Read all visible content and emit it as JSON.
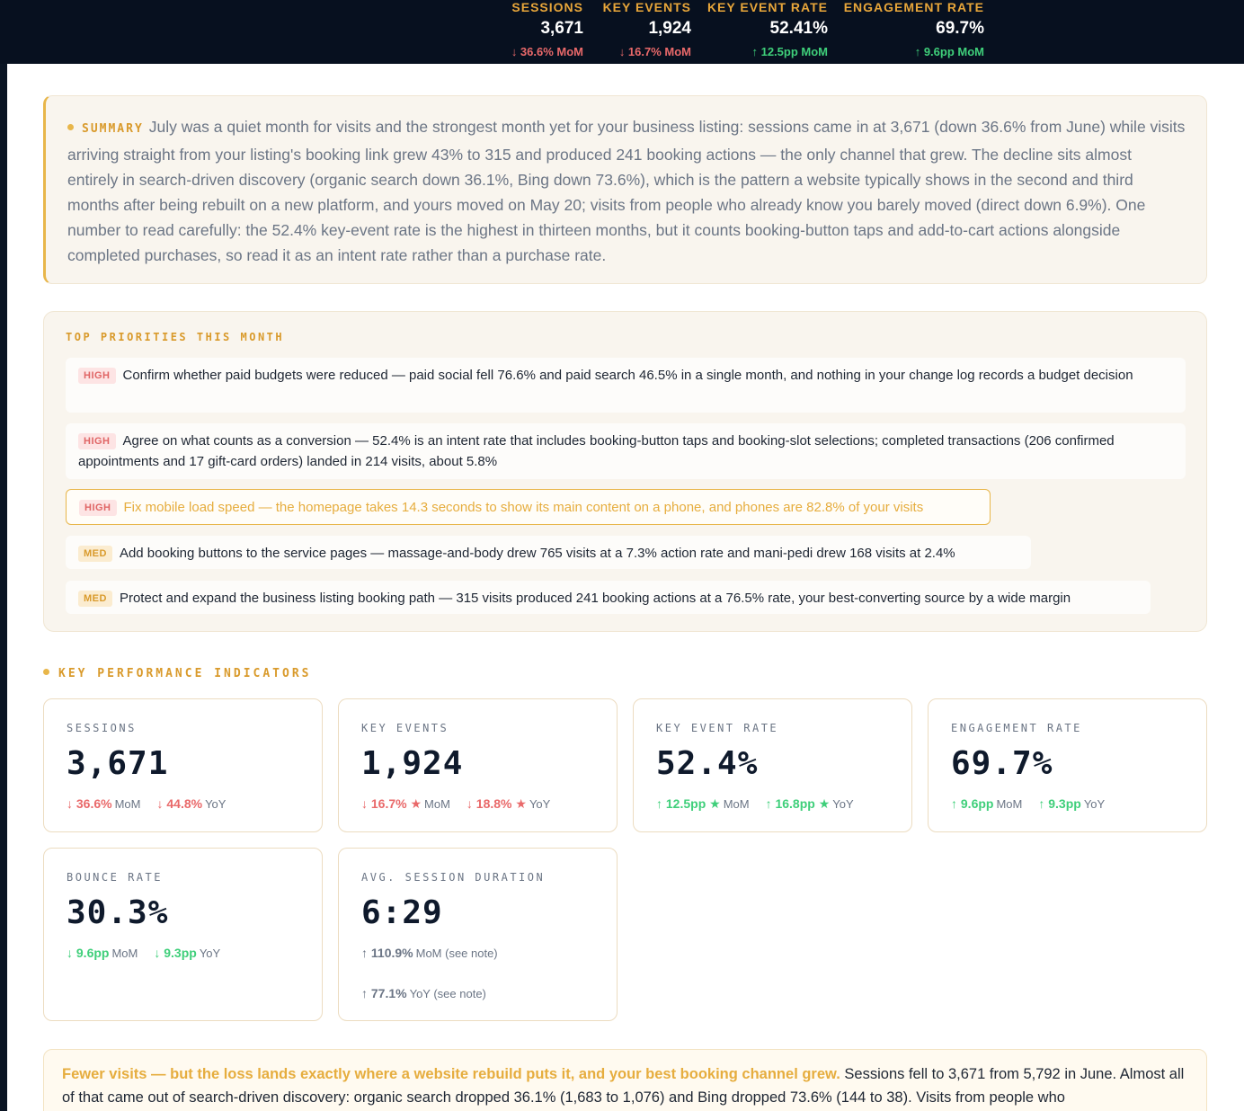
{
  "header": {
    "kpis": [
      {
        "label": "SESSIONS",
        "value": "3,671",
        "change": "↓ 36.6% MoM",
        "dir": "down-red"
      },
      {
        "label": "KEY EVENTS",
        "value": "1,924",
        "change": "↓ 16.7% MoM",
        "dir": "down-red"
      },
      {
        "label": "KEY EVENT RATE",
        "value": "52.41%",
        "change": "↑ 12.5pp MoM",
        "dir": "up-green"
      },
      {
        "label": "ENGAGEMENT RATE",
        "value": "69.7%",
        "change": "↑ 9.6pp MoM",
        "dir": "up-green"
      }
    ]
  },
  "summary": {
    "tag": "SUMMARY",
    "text": "July was a quiet month for visits and the strongest month yet for your business listing: sessions came in at 3,671 (down 36.6% from June) while visits arriving straight from your listing's booking link grew 43% to 315 and produced 241 booking actions — the only channel that grew. The decline sits almost entirely in search-driven discovery (organic search down 36.1%, Bing down 73.6%), which is the pattern a website typically shows in the second and third months after being rebuilt on a new platform, and yours moved on May 20; visits from people who already know you barely moved (direct down 6.9%). One number to read carefully: the 52.4% key-event rate is the highest in thirteen months, but it counts booking-button taps and add-to-cart actions alongside completed purchases, so read it as an intent rate rather than a purchase rate."
  },
  "priorities": {
    "title": "TOP PRIORITIES THIS MONTH",
    "items": [
      {
        "level": "HIGH",
        "text": "Confirm whether paid budgets were reduced — paid social fell 76.6% and paid search 46.5% in a single month, and nothing in your change log records a budget decision"
      },
      {
        "level": "HIGH",
        "text": "Agree on what counts as a conversion — 52.4% is an intent rate that includes booking-button taps and booking-slot selections; completed transactions (206 confirmed appointments and 17 gift-card orders) landed in 214 visits, about 5.8%"
      },
      {
        "level": "HIGH",
        "text": "Fix mobile load speed — the homepage takes 14.3 seconds to show its main content on a phone, and phones are 82.8% of your visits"
      },
      {
        "level": "MED",
        "text": "Add booking buttons to the service pages — massage-and-body drew 765 visits at a 7.3% action rate and mani-pedi drew 168 visits at 2.4%"
      },
      {
        "level": "MED",
        "text": "Protect and expand the business listing booking path — 315 visits produced 241 booking actions at a 76.5% rate, your best-converting source by a wide margin"
      }
    ]
  },
  "kpi_section": {
    "title": "KEY PERFORMANCE INDICATORS",
    "cards": [
      {
        "label": "SESSIONS",
        "value": "3,671",
        "mom": "↓ 36.6%",
        "mom_label": "MoM",
        "yoy": "↓ 44.8%",
        "yoy_label": "YoY"
      },
      {
        "label": "KEY EVENTS",
        "value": "1,924",
        "mom": "↓ 16.7% ★",
        "mom_label": "MoM",
        "yoy": "↓ 18.8% ★",
        "yoy_label": "YoY"
      },
      {
        "label": "KEY EVENT RATE",
        "value": "52.4%",
        "mom": "↑ 12.5pp ★",
        "mom_label": "MoM",
        "yoy": "↑ 16.8pp ★",
        "yoy_label": "YoY"
      },
      {
        "label": "ENGAGEMENT RATE",
        "value": "69.7%",
        "mom": "↑ 9.6pp",
        "mom_label": "MoM",
        "yoy": "↑ 9.3pp",
        "yoy_label": "YoY"
      },
      {
        "label": "BOUNCE RATE",
        "value": "30.3%",
        "mom": "↓ 9.6pp",
        "mom_label": "MoM",
        "yoy": "↓ 9.3pp",
        "yoy_label": "YoY"
      },
      {
        "label": "AVG. SESSION DURATION",
        "value": "6:29",
        "mom": "↑ 110.9%",
        "mom_label": "MoM (see note)",
        "yoy": "↑ 77.1%",
        "yoy_label": "YoY (see note)"
      }
    ]
  },
  "insight": {
    "lead": "Fewer visits — but the loss lands exactly where a website rebuild puts it, and your best booking channel grew.",
    "text": " Sessions fell to 3,671 from 5,792 in June. Almost all of that came out of search-driven discovery: organic search dropped 36.1% (1,683 to 1,076) and Bing dropped 73.6% (144 to 38). Visits from people who"
  },
  "colors": {
    "accent": "#e8b64a",
    "negative": "#e9696a",
    "positive": "#3fcf7a",
    "header_bg": "#07101f"
  }
}
